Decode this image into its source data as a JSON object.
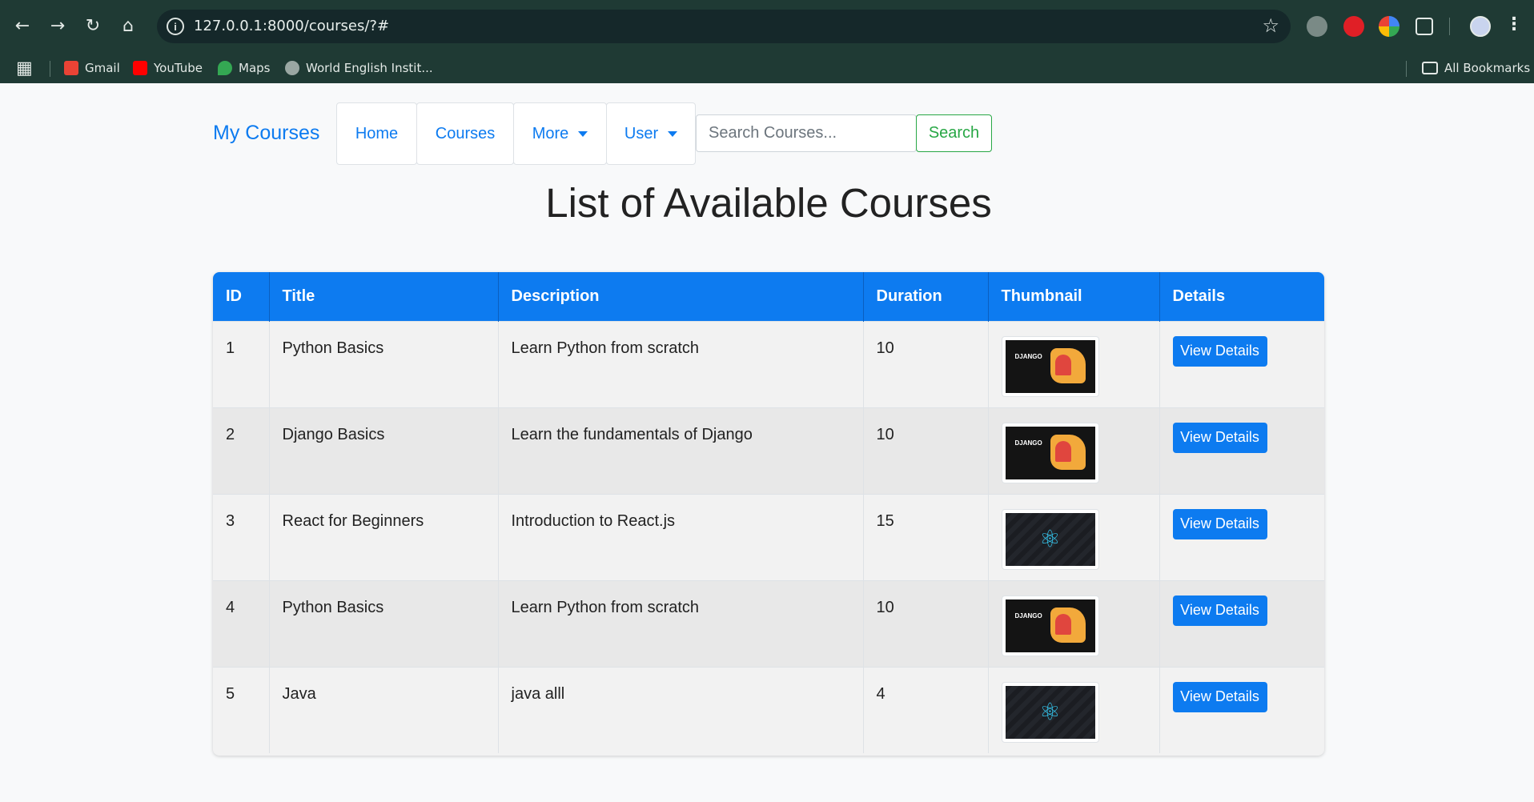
{
  "browser": {
    "url": "127.0.0.1:8000/courses/?#",
    "bookmarks": [
      {
        "label": "Gmail",
        "icon": "gmail-icon",
        "color": "#ea4335"
      },
      {
        "label": "YouTube",
        "icon": "youtube-icon",
        "color": "#ff0000"
      },
      {
        "label": "Maps",
        "icon": "maps-icon",
        "color": "#34a853"
      },
      {
        "label": "World English Instit...",
        "icon": "globe-icon",
        "color": "#9aa7a3"
      }
    ],
    "all_bookmarks": "All Bookmarks"
  },
  "navbar": {
    "brand": "My Courses",
    "home": "Home",
    "courses": "Courses",
    "more": "More",
    "user": "User",
    "search_placeholder": "Search Courses...",
    "search_button": "Search"
  },
  "page": {
    "title": "List of Available Courses"
  },
  "table": {
    "headers": {
      "id": "ID",
      "title": "Title",
      "description": "Description",
      "duration": "Duration",
      "thumbnail": "Thumbnail",
      "details": "Details"
    },
    "rows": [
      {
        "id": "1",
        "title": "Python Basics",
        "description": "Learn Python from scratch",
        "duration": "10",
        "thumbnail": "django",
        "thumb_title": "DJANGO",
        "details": "View Details"
      },
      {
        "id": "2",
        "title": "Django Basics",
        "description": "Learn the fundamentals of Django",
        "duration": "10",
        "thumbnail": "django",
        "thumb_title": "DJANGO",
        "details": "View Details"
      },
      {
        "id": "3",
        "title": "React for Beginners",
        "description": "Introduction to React.js",
        "duration": "15",
        "thumbnail": "react",
        "details": "View Details"
      },
      {
        "id": "4",
        "title": "Python Basics",
        "description": "Learn Python from scratch",
        "duration": "10",
        "thumbnail": "django",
        "thumb_title": "DJANGO",
        "details": "View Details"
      },
      {
        "id": "5",
        "title": "Java",
        "description": "java alll",
        "duration": "4",
        "thumbnail": "react",
        "details": "View Details"
      }
    ]
  },
  "colors": {
    "primary": "#0d7bf0",
    "success": "#28a745",
    "chrome": "#1f3a34"
  }
}
